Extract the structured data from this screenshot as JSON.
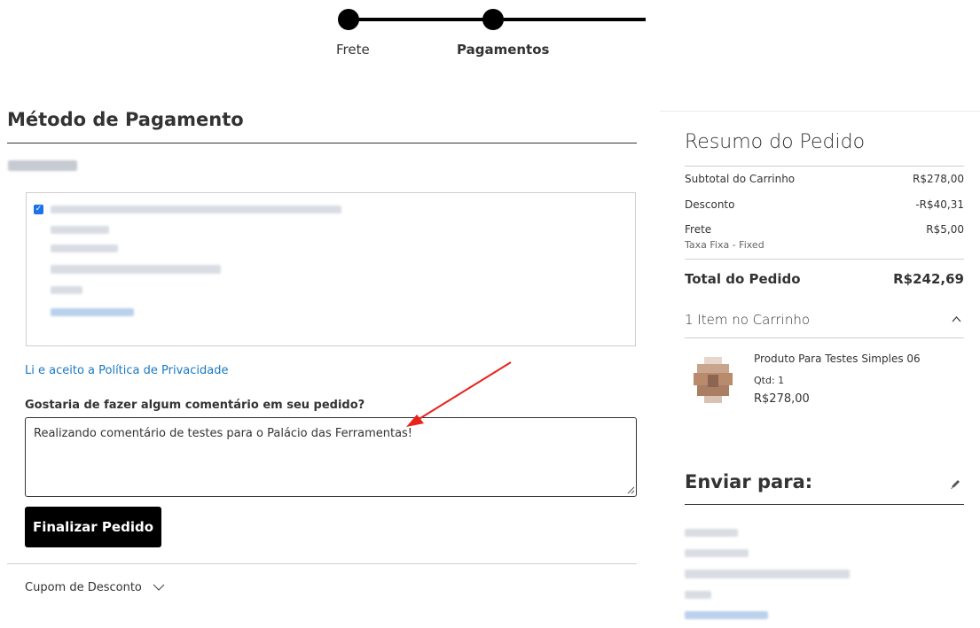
{
  "progress": {
    "steps": [
      {
        "label": "Frete"
      },
      {
        "label": "Pagamentos"
      }
    ]
  },
  "payment": {
    "title": "Método de Pagamento",
    "privacy_link": "Li e aceito a Política de Privacidade",
    "comment_label": "Gostaria de fazer algum comentário em seu pedido?",
    "comment_value": "Realizando comentário de testes para o Palácio das Ferramentas!",
    "submit_label": "Finalizar Pedido",
    "coupon_label": "Cupom de Desconto"
  },
  "summary": {
    "title": "Resumo do Pedido",
    "subtotal_label": "Subtotal do Carrinho",
    "subtotal_value": "R$278,00",
    "discount_label": "Desconto",
    "discount_value": "-R$40,31",
    "shipping_label": "Frete",
    "shipping_value": "R$5,00",
    "shipping_method": "Taxa Fixa - Fixed",
    "total_label": "Total do Pedido",
    "total_value": "R$242,69",
    "cart_count": "1 Item no Carrinho",
    "product": {
      "name": "Produto Para Testes Simples 06",
      "qty": "Qtd: 1",
      "price": "R$278,00"
    },
    "ship_to_title": "Enviar para:"
  },
  "icons": {
    "chevron_down": "chevron-down-icon",
    "chevron_up": "chevron-up-icon",
    "edit": "pencil-icon",
    "checkbox": "checkmark-icon"
  },
  "colors": {
    "link": "#1979c3",
    "button_bg": "#000000",
    "arrow": "#e8231c"
  }
}
